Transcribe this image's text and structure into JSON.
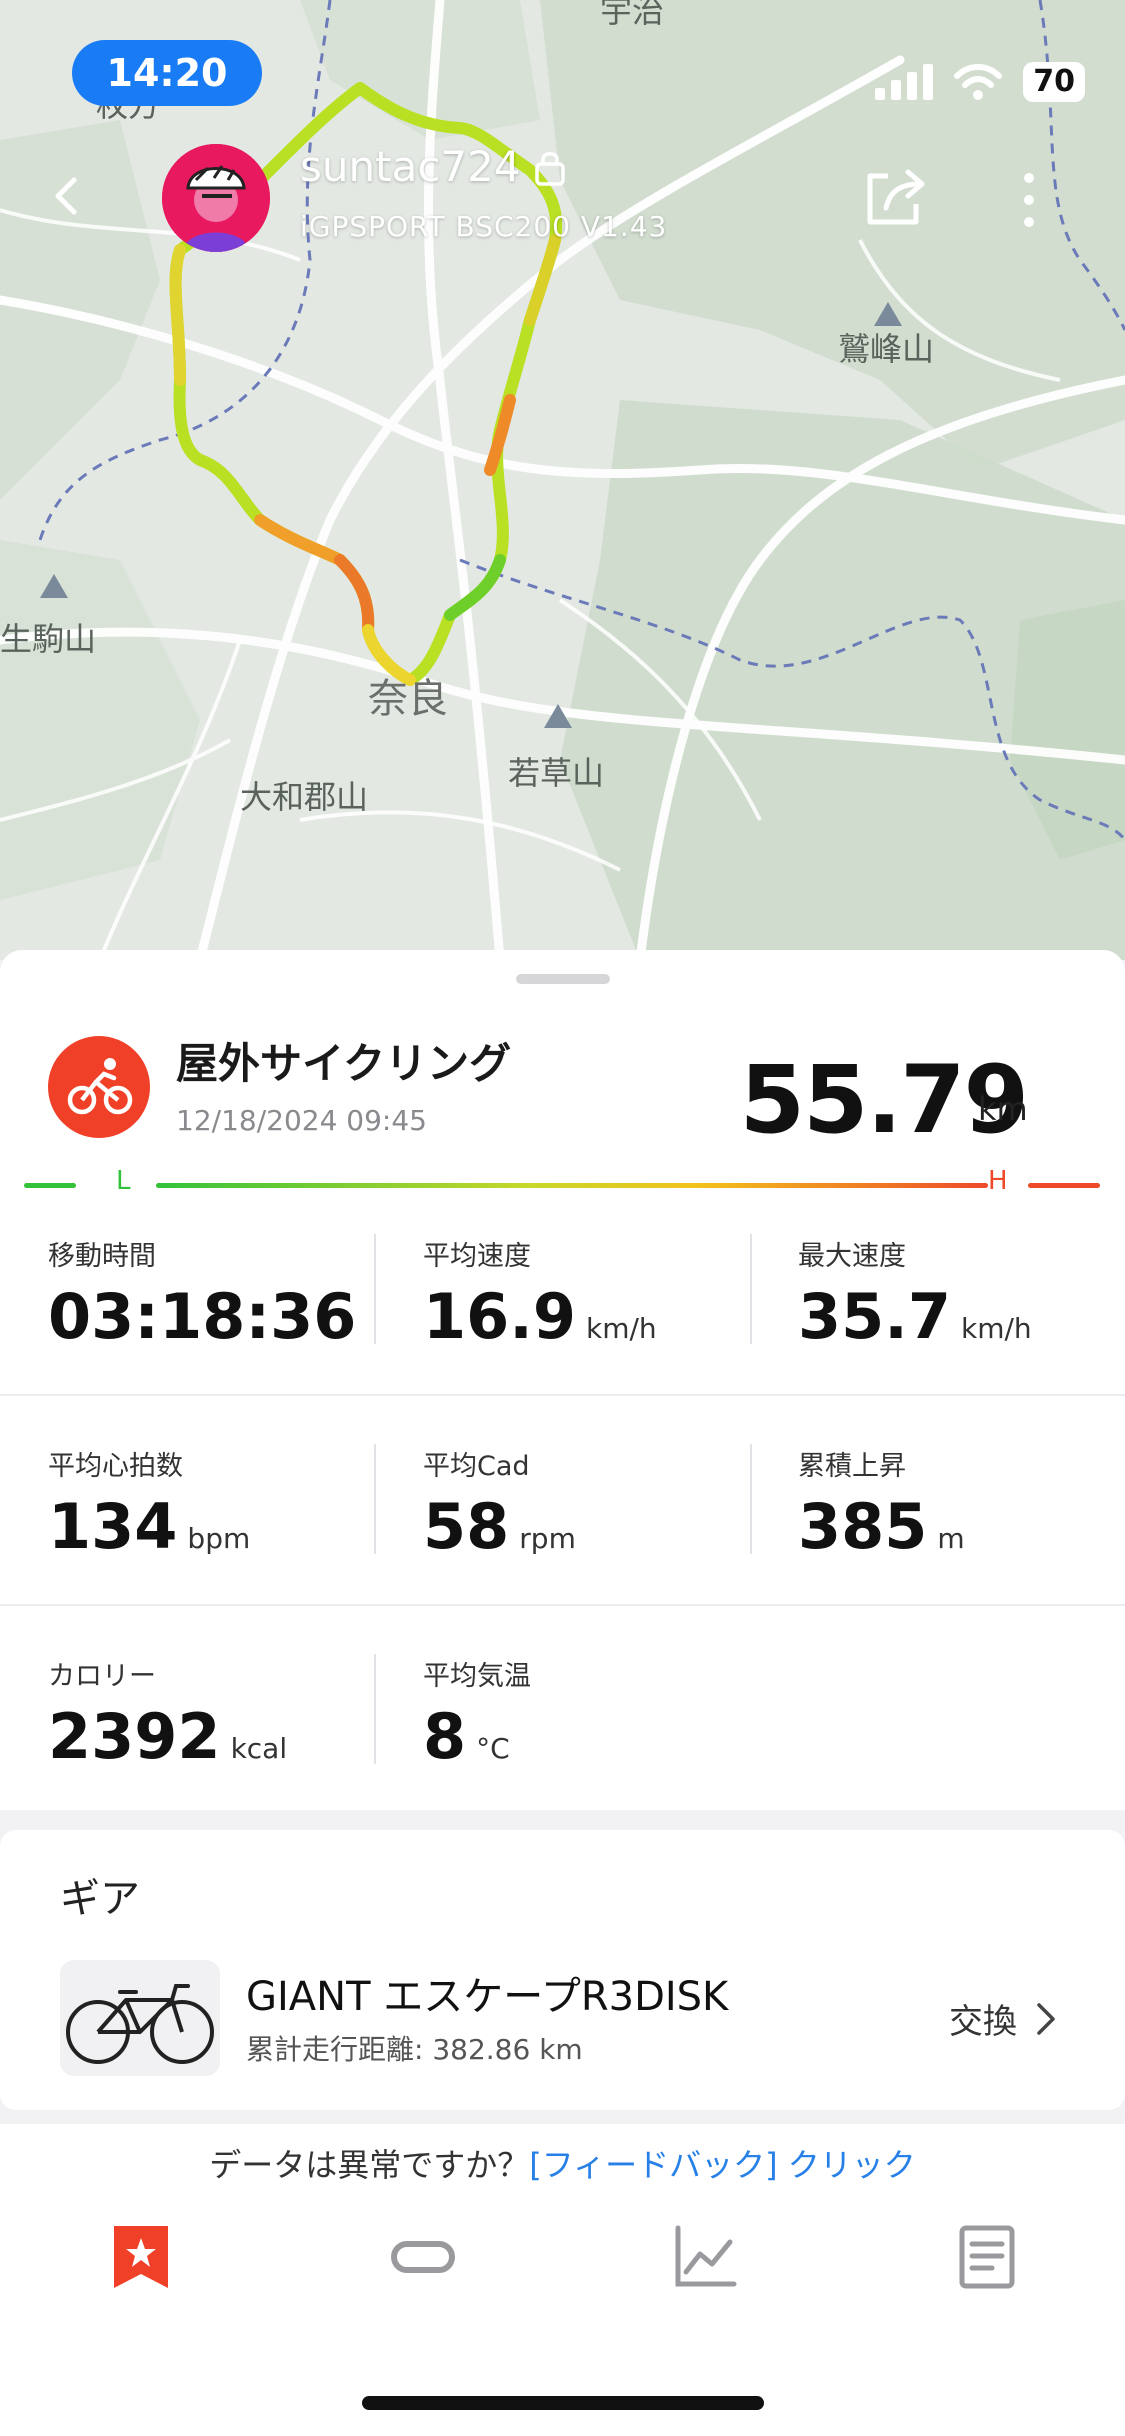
{
  "status_bar": {
    "time": "14:20",
    "battery": "70"
  },
  "header": {
    "username": "suntac724",
    "device": "iGPSPORT BSC200 V1.43"
  },
  "map": {
    "labels": {
      "top_partial": "宇治",
      "left_partial": "枚方",
      "washimine": "鷲峰山",
      "ikoma": "生駒山",
      "nara": "奈良",
      "wakakusa": "若草山",
      "yamatokoriyama": "大和郡山"
    }
  },
  "activity": {
    "title": "屋外サイクリング",
    "datetime": "12/18/2024 09:45",
    "distance": "55.79",
    "distance_unit": "km",
    "scale_low": "L",
    "scale_high": "H"
  },
  "stats": [
    {
      "label": "移動時間",
      "value": "03:18:36",
      "unit": ""
    },
    {
      "label": "平均速度",
      "value": "16.9",
      "unit": "km/h"
    },
    {
      "label": "最大速度",
      "value": "35.7",
      "unit": "km/h"
    },
    {
      "label": "平均心拍数",
      "value": "134",
      "unit": "bpm"
    },
    {
      "label": "平均Cad",
      "value": "58",
      "unit": "rpm"
    },
    {
      "label": "累積上昇",
      "value": "385",
      "unit": "m"
    },
    {
      "label": "カロリー",
      "value": "2392",
      "unit": "kcal"
    },
    {
      "label": "平均気温",
      "value": "8",
      "unit": "°C"
    }
  ],
  "gear": {
    "title": "ギア",
    "bike_name": "GIANT エスケープR3DISK",
    "mileage": "累計走行距離: 382.86 km",
    "exchange_label": "交換"
  },
  "feedback": {
    "question": "データは異常ですか？",
    "link": "[フィードバック] クリック"
  },
  "colors": {
    "accent_red": "#f04028",
    "link_blue": "#2680e8",
    "time_pill": "#1a7cf5"
  },
  "tabs": [
    {
      "name": "overview",
      "icon": "star-bookmark-icon",
      "active": true
    },
    {
      "name": "route",
      "icon": "track-loop-icon",
      "active": false
    },
    {
      "name": "charts",
      "icon": "chart-line-icon",
      "active": false
    },
    {
      "name": "details",
      "icon": "document-icon",
      "active": false
    }
  ]
}
